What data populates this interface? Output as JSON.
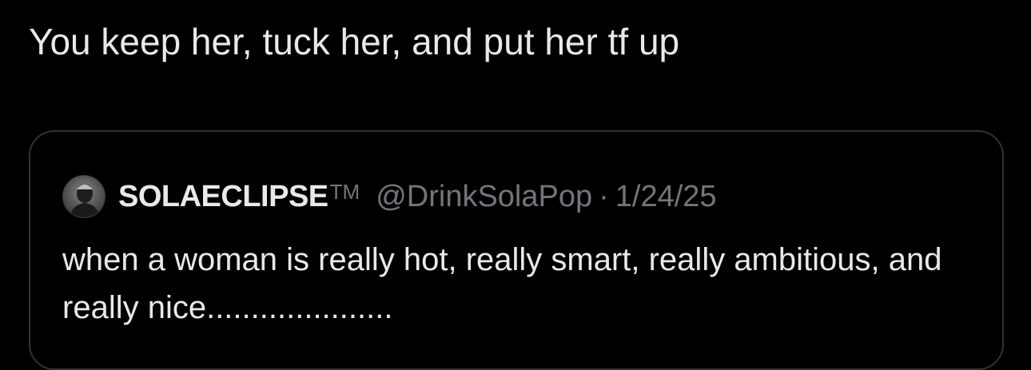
{
  "tweet": {
    "text": "You keep her, tuck her, and put her tf up"
  },
  "quoted_tweet": {
    "display_name": "SOLAECLIPSE",
    "name_suffix": "TM",
    "handle": "@DrinkSolaPop",
    "separator": "·",
    "date": "1/24/25",
    "body": "when a woman is really hot, really smart, really ambitious, and really nice.....................",
    "avatar_icon": "person-avatar-icon"
  },
  "colors": {
    "background": "#000000",
    "primary_text": "#e7e9ea",
    "secondary_text": "#71767b",
    "border": "#2f3336"
  }
}
